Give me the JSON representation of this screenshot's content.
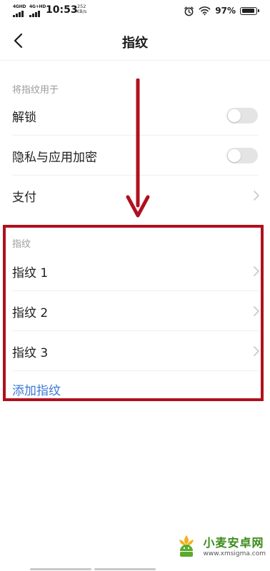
{
  "status_bar": {
    "sim1_label": "4GHD",
    "sim2_label": "4G+HD",
    "time": "10:53",
    "net_speed_value": "252",
    "net_speed_unit": "KB/s",
    "battery_percent": "97%",
    "battery_level": 0.97,
    "icons": [
      "alarm-icon",
      "wifi-icon",
      "battery-icon"
    ]
  },
  "header": {
    "title": "指纹",
    "back_icon": "chevron-left-icon"
  },
  "usage_section": {
    "label": "将指纹用于",
    "items": [
      {
        "label": "解锁",
        "control": "toggle",
        "on": false
      },
      {
        "label": "隐私与应用加密",
        "control": "toggle",
        "on": false
      },
      {
        "label": "支付",
        "control": "chevron-right-icon"
      }
    ]
  },
  "fingerprint_section": {
    "label": "指纹",
    "items": [
      {
        "label": "指纹 1"
      },
      {
        "label": "指纹 2"
      },
      {
        "label": "指纹 3"
      }
    ],
    "add_label": "添加指纹"
  },
  "annotation": {
    "arrow_color": "#b0101e",
    "box_color": "#b0101e"
  },
  "watermark": {
    "title": "小麦安卓网",
    "url": "www.xmsigma.com"
  },
  "colors": {
    "link": "#3f7ad6",
    "section_label": "#9a9a9a",
    "toggle_off": "#e4e4e4"
  }
}
